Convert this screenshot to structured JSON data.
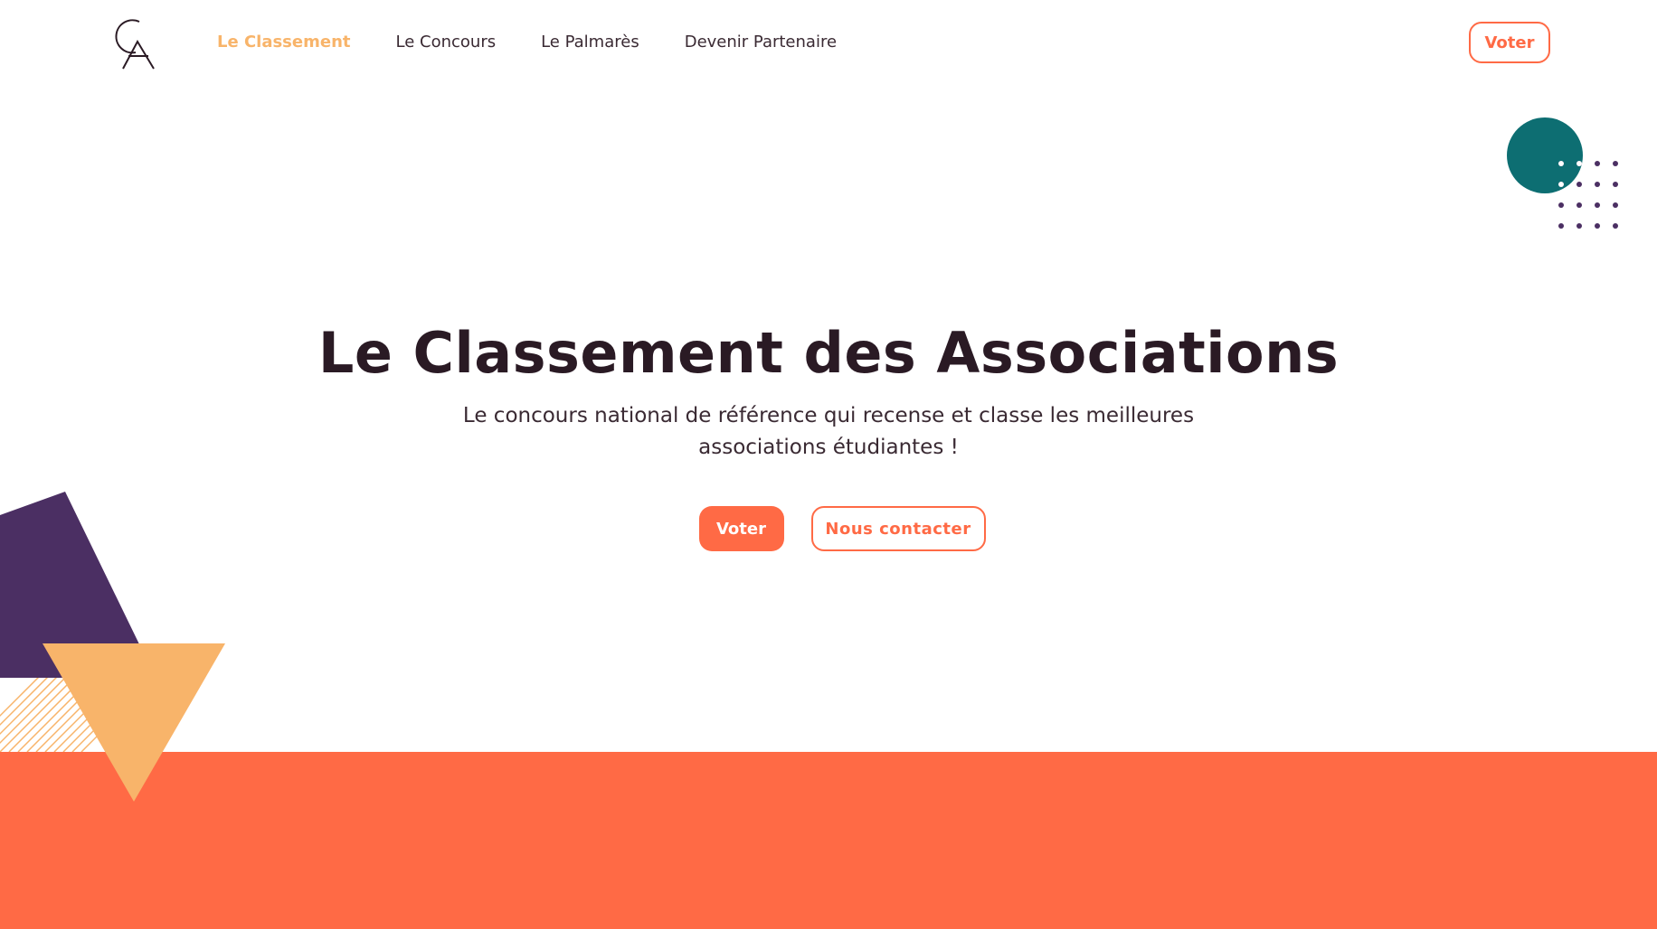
{
  "header": {
    "logo_icon": "ca-monogram-logo",
    "nav": [
      {
        "label": "Le Classement",
        "active": true
      },
      {
        "label": "Le Concours",
        "active": false
      },
      {
        "label": "Le Palmarès",
        "active": false
      },
      {
        "label": "Devenir Partenaire",
        "active": false
      }
    ],
    "vote_label": "Voter"
  },
  "hero": {
    "title": "Le Classement des Associations",
    "subtitle": "Le concours national de référence qui recense et classe les meilleures associations étudiantes !",
    "primary_button": "Voter",
    "secondary_button": "Nous contacter"
  },
  "colors": {
    "accent_orange": "#ff6a45",
    "accent_yellow": "#f8b46a",
    "purple": "#4b2f63",
    "teal": "#0d6e72",
    "text_dark": "#2a1a24"
  }
}
